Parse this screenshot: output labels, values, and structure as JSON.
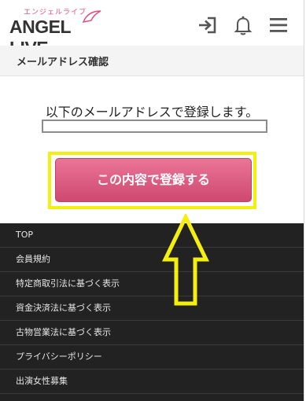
{
  "header": {
    "logo_kana": "エンジェルライブ",
    "logo_text": "ANGEL LIVE",
    "icons": [
      "login-icon",
      "bell-icon",
      "hamburger-menu-icon"
    ]
  },
  "page": {
    "title": "メールアドレス確認",
    "instruction": "以下のメールアドレスで登録します。",
    "email_value": "",
    "register_button": "この内容で登録する"
  },
  "footer": {
    "links": [
      "TOP",
      "会員規約",
      "特定商取引法に基づく表示",
      "資金決済法に基づく表示",
      "古物営業法に基づく表示",
      "プライバシーポリシー",
      "出演女性募集"
    ]
  },
  "colors": {
    "brand_pink": "#e24c83",
    "button_pink": "#d6527a",
    "highlight_yellow": "#f5ef0f",
    "footer_bg": "#222222"
  }
}
